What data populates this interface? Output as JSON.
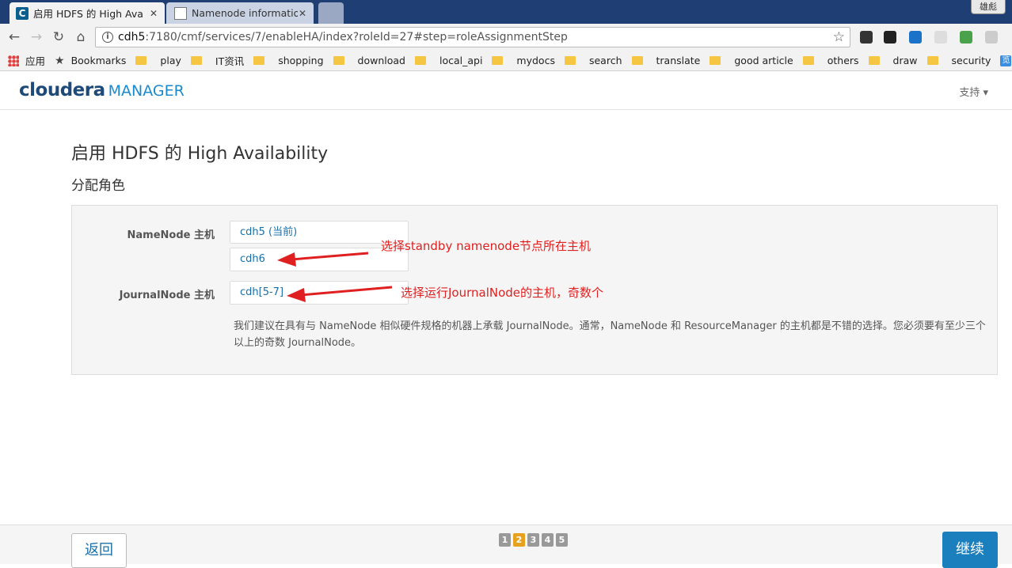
{
  "browser": {
    "tabs": [
      {
        "title": "启用 HDFS 的 High Ava",
        "active": true,
        "icon": "cloudera-favicon"
      },
      {
        "title": "Namenode information",
        "active": false,
        "icon": "page-icon"
      }
    ],
    "profile_label": "雄彪",
    "url_host": "cdh5",
    "url_rest": ":7180/cmf/services/7/enableHA/index?roleId=27#step=roleAssignmentStep",
    "bookmarks": [
      {
        "label": "应用",
        "icon": "apps-icon"
      },
      {
        "label": "Bookmarks",
        "icon": "star-icon"
      },
      {
        "label": "play",
        "icon": "folder-icon"
      },
      {
        "label": "IT资讯",
        "icon": "folder-icon"
      },
      {
        "label": "shopping",
        "icon": "folder-icon"
      },
      {
        "label": "download",
        "icon": "folder-icon"
      },
      {
        "label": "local_api",
        "icon": "folder-icon"
      },
      {
        "label": "mydocs",
        "icon": "folder-icon"
      },
      {
        "label": "search",
        "icon": "folder-icon"
      },
      {
        "label": "translate",
        "icon": "folder-icon"
      },
      {
        "label": "good article",
        "icon": "folder-icon"
      },
      {
        "label": "others",
        "icon": "folder-icon"
      },
      {
        "label": "draw",
        "icon": "folder-icon"
      },
      {
        "label": "security",
        "icon": "folder-icon"
      },
      {
        "label": "一览",
        "icon": "yilan-icon"
      }
    ]
  },
  "app": {
    "logo_brand": "cloudera",
    "logo_product": "MANAGER",
    "support_menu": "支持 ▾",
    "page_title": "启用 HDFS 的 High Availability",
    "step_title": "分配角色",
    "namenode": {
      "label": "NameNode 主机",
      "current_host": "cdh5 (当前)",
      "selected_host": "cdh6"
    },
    "journalnode": {
      "label": "JournalNode 主机",
      "selected_hosts": "cdh[5-7]"
    },
    "hint": "我们建议在具有与 NameNode 相似硬件规格的机器上承载 JournalNode。通常，NameNode 和 ResourceManager 的主机都是不错的选择。您必须要有至少三个以上的奇数 JournalNode。",
    "annotations": {
      "namenode": "选择standby namenode节点所在主机",
      "journalnode": "选择运行JournalNode的主机，奇数个"
    },
    "footer": {
      "back_label": "返回",
      "continue_label": "继续",
      "steps": [
        "1",
        "2",
        "3",
        "4",
        "5"
      ],
      "current_step": "2"
    }
  },
  "colors": {
    "link_blue": "#1a6fa8",
    "primary_button": "#1a7fbc",
    "active_step": "#e6a21f",
    "annotation_red": "#e02020"
  }
}
